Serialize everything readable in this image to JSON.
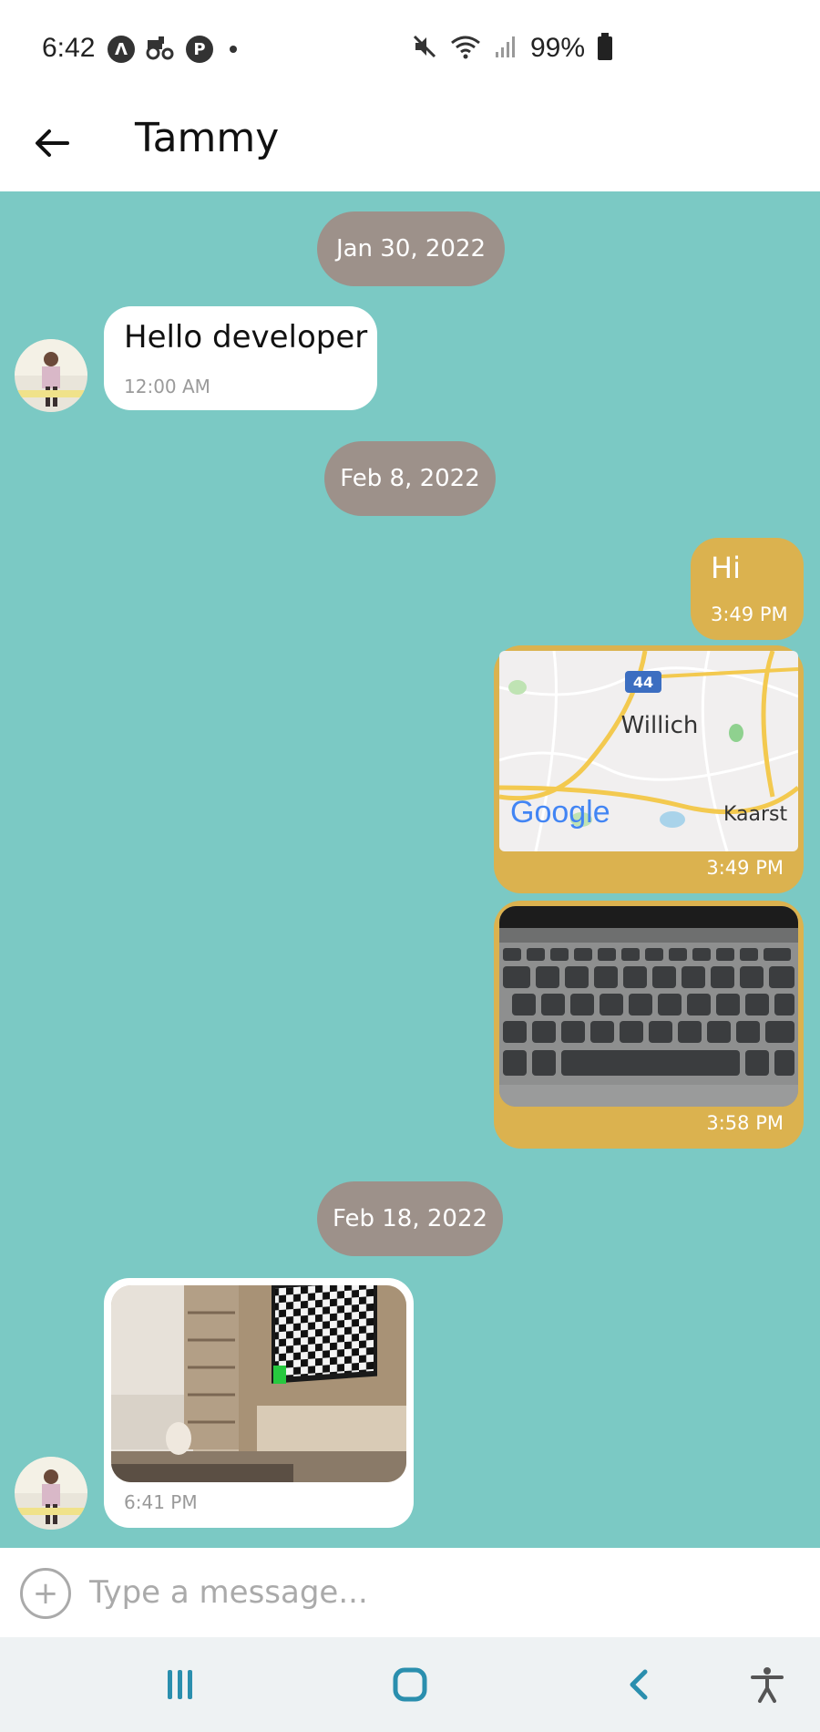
{
  "status_bar": {
    "time": "6:42",
    "battery": "99%",
    "icons": [
      "notification-a-icon",
      "tractor-icon",
      "pinterest-icon",
      "dot-icon",
      "mute-icon",
      "wifi-icon",
      "signal-icon",
      "battery-icon"
    ]
  },
  "header": {
    "title": "Tammy",
    "back_icon": "arrow-left-icon"
  },
  "colors": {
    "chat_bg": "#7bc9c4",
    "incoming_bubble": "#ffffff",
    "outgoing_bubble": "#dbb24f",
    "date_pill": "#9d918a"
  },
  "messages": {
    "date1": "Jan 30, 2022",
    "m1_text": "Hello developer",
    "m1_time": "12:00 AM",
    "date2": "Feb 8, 2022",
    "m2_text": "Hi",
    "m2_time": "3:49 PM",
    "m3_map_label_city": "Willich",
    "m3_map_label_town": "Kaarst",
    "m3_map_route": "44",
    "m3_map_brand": "Google",
    "m3_time": "3:49 PM",
    "m4_time": "3:58 PM",
    "date3": "Feb 18, 2022",
    "m5_time": "6:41 PM"
  },
  "input": {
    "placeholder": "Type a message...",
    "value": ""
  }
}
